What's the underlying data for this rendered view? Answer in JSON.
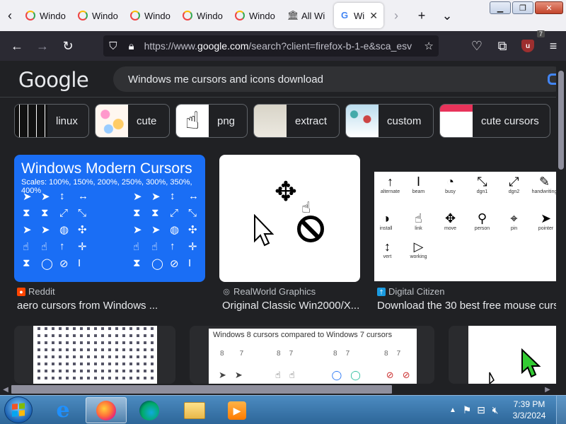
{
  "tabs": {
    "items": [
      {
        "label": "Windo"
      },
      {
        "label": "Windo"
      },
      {
        "label": "Windo"
      },
      {
        "label": "Windo"
      },
      {
        "label": "Windo"
      },
      {
        "label": "All Wi"
      }
    ],
    "active": {
      "label": "Wi"
    }
  },
  "window_controls": {
    "minimize": "▁",
    "maximize": "❐",
    "close": "✕"
  },
  "navbar": {
    "url_prefix": "https://www.",
    "url_host": "google.com",
    "url_rest": "/search?client=firefox-b-1-e&sca_esv",
    "extension_badge": "7",
    "extension_letter": "u"
  },
  "google": {
    "logo": "Google",
    "query": "Windows me cursors and icons download"
  },
  "chips": [
    {
      "label": "linux",
      "thumb": "dark"
    },
    {
      "label": "cute",
      "thumb": "cute"
    },
    {
      "label": "png",
      "thumb": "png"
    },
    {
      "label": "extract",
      "thumb": "extract"
    },
    {
      "label": "custom",
      "thumb": "custom"
    },
    {
      "label": "cute cursors",
      "thumb": "cutecur"
    }
  ],
  "results": [
    {
      "image_title": "Windows Modern Cursors",
      "image_subtitle": "Scales: 100%, 150%, 200%, 250%, 300%, 350%, 400%",
      "source": "Reddit",
      "title": "aero cursors from Windows ..."
    },
    {
      "source": "RealWorld Graphics",
      "title": "Original Classic Win2000/X..."
    },
    {
      "source": "Digital Citizen",
      "title": "Download the 30 best free mouse curs",
      "cursor_labels": [
        "alternate",
        "beam",
        "busy",
        "dgn1",
        "dgn2",
        "handwriting",
        "install",
        "link",
        "move",
        "person",
        "pin",
        "pointer",
        "vert",
        "working"
      ]
    },
    {},
    {
      "image_title": "Windows 8 cursors compared to Windows 7 cursors",
      "numbers": [
        "8",
        "7",
        "8",
        "7",
        "8",
        "7",
        "8",
        "7"
      ]
    },
    {}
  ],
  "taskbar": {
    "time": "7:39 PM",
    "date": "3/3/2024"
  },
  "colors": {
    "page_bg": "#202124",
    "tab_strip": "#f0f0f4",
    "navbar": "#2b2a33",
    "modern_cursors_bg": "#1a6ef5",
    "taskbar": "#2d6699"
  }
}
